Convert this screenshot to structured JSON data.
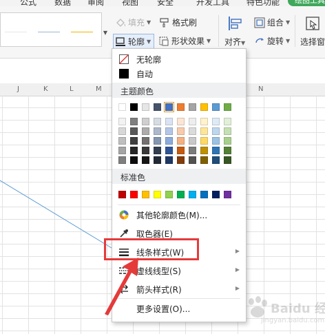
{
  "menubar": {
    "tabs": [
      "公式",
      "数据",
      "审阅",
      "视图",
      "安全",
      "开发工具",
      "特色功能"
    ],
    "green_pill": "绘图工具"
  },
  "ribbon": {
    "fill_label": "填充",
    "format_brush_label": "格式刷",
    "outline_label": "轮廓",
    "shape_effect_label": "形状效果",
    "group_label": "组合",
    "rotate_label": "旋转",
    "align_label": "对齐",
    "select_pane_label": "选择窗",
    "style_line_colors": [
      "#ffffff",
      "#9cb4d8",
      "#f0b400"
    ]
  },
  "sheet": {
    "columns": [
      "J",
      "K",
      "L",
      "M",
      "N"
    ]
  },
  "dropdown": {
    "no_outline": "无轮廓",
    "automatic": "自动",
    "theme_colors_header": "主题颜色",
    "theme_top_row": [
      "#ffffff",
      "#000000",
      "#e7e6e6",
      "#44546a",
      "#4472c4",
      "#ed7d31",
      "#a5a5a5",
      "#ffc000",
      "#5b9bd5",
      "#70ad47"
    ],
    "theme_shades": [
      [
        "#f2f2f2",
        "#7f7f7f",
        "#d0cece",
        "#d6dce4",
        "#dae3f3",
        "#fbe5d5",
        "#ededed",
        "#fff2cc",
        "#deebf6",
        "#e2efd9"
      ],
      [
        "#d8d8d8",
        "#595959",
        "#aeabab",
        "#adb9ca",
        "#b4c6e7",
        "#f7cbac",
        "#dbdbdb",
        "#fee599",
        "#bdd7ee",
        "#c5e0b3"
      ],
      [
        "#bfbfbf",
        "#3f3f3f",
        "#757070",
        "#8496b0",
        "#8eaadb",
        "#f4b183",
        "#c9c9c9",
        "#ffd965",
        "#9cc3e5",
        "#a8d08d"
      ],
      [
        "#a5a5a5",
        "#262626",
        "#3a3838",
        "#323f4f",
        "#2f5496",
        "#c55a11",
        "#7b7b7b",
        "#bf9000",
        "#2e75b5",
        "#538135"
      ],
      [
        "#7f7f7f",
        "#0c0c0c",
        "#171616",
        "#222a35",
        "#1f3864",
        "#833c0b",
        "#525252",
        "#7f6000",
        "#1e4e79",
        "#375623"
      ]
    ],
    "standard_colors_header": "标准色",
    "standard_colors": [
      "#c00000",
      "#ff0000",
      "#ffc000",
      "#ffff00",
      "#92d050",
      "#00b050",
      "#00b0f0",
      "#0070c0",
      "#002060",
      "#7030a0"
    ],
    "more_colors": "其他轮廓颜色(M)...",
    "eyedropper": "取色器(E)",
    "line_style": "线条样式(W)",
    "dash_type": "虚线线型(S)",
    "arrow_style": "箭头样式(R)",
    "more_settings": "更多设置(O)..."
  },
  "annotation": {
    "highlight_color": "#e53a3a"
  },
  "watermark": {
    "text": "Baidu 经验",
    "url": "jingyan.baidu.com"
  }
}
